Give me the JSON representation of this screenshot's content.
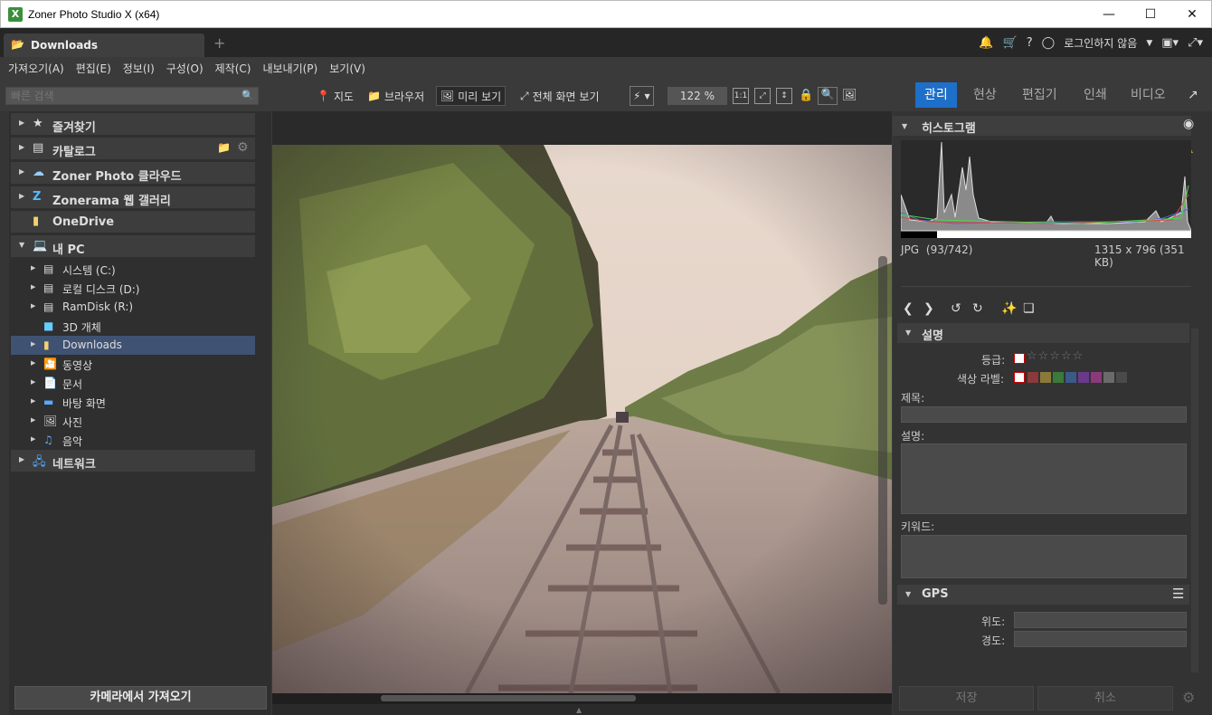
{
  "window": {
    "title": "Zoner Photo Studio X (x64)",
    "logo_text": "X"
  },
  "tabs": {
    "active_label": "Downloads",
    "new_tab": "+"
  },
  "topbar": {
    "user": "로그인하지 않음"
  },
  "menu": [
    "가져오기(A)",
    "편집(E)",
    "정보(I)",
    "구성(O)",
    "제작(C)",
    "내보내기(P)",
    "보기(V)"
  ],
  "toolbar": {
    "search_placeholder": "빠른 검색",
    "map": "지도",
    "browser": "브라우저",
    "preview": "미리 보기",
    "fullscreen": "전체 화면 보기",
    "zoom": "122 %",
    "ratio": "1:1"
  },
  "modes": [
    "관리",
    "현상",
    "편집기",
    "인쇄",
    "비디오"
  ],
  "left": {
    "sections": [
      "즐겨찾기",
      "카탈로그",
      "Zoner Photo 클라우드",
      "Zonerama 웹 갤러리",
      "OneDrive",
      "내 PC"
    ],
    "tree": [
      "시스템 (C:)",
      "로컬 디스크 (D:)",
      "RamDisk (R:)",
      "3D 개체",
      "Downloads",
      "동영상",
      "문서",
      "바탕 화면",
      "사진",
      "음악"
    ],
    "network": "네트워크",
    "import_button": "카메라에서 가져오기"
  },
  "right": {
    "histogram_title": "히스토그램",
    "file_type": "JPG",
    "file_index": "(93/742)",
    "file_dims": "1315 x 796 (351 KB)",
    "desc_section": "설명",
    "rating_label": "등급:",
    "color_label": "색상 라벨:",
    "title_label": "제목:",
    "description_label": "설명:",
    "keywords_label": "키워드:",
    "gps_section": "GPS",
    "lat_label": "위도:",
    "lon_label": "경도:",
    "save": "저장",
    "cancel": "취소",
    "color_swatches": [
      "#8a3a3a",
      "#8a7a3a",
      "#3a7a3a",
      "#3a5a8a",
      "#6a3a8a",
      "#8a3a7a",
      "#6a6a6a",
      "#4a4a4a"
    ],
    "accent": "#1e6fc9"
  }
}
